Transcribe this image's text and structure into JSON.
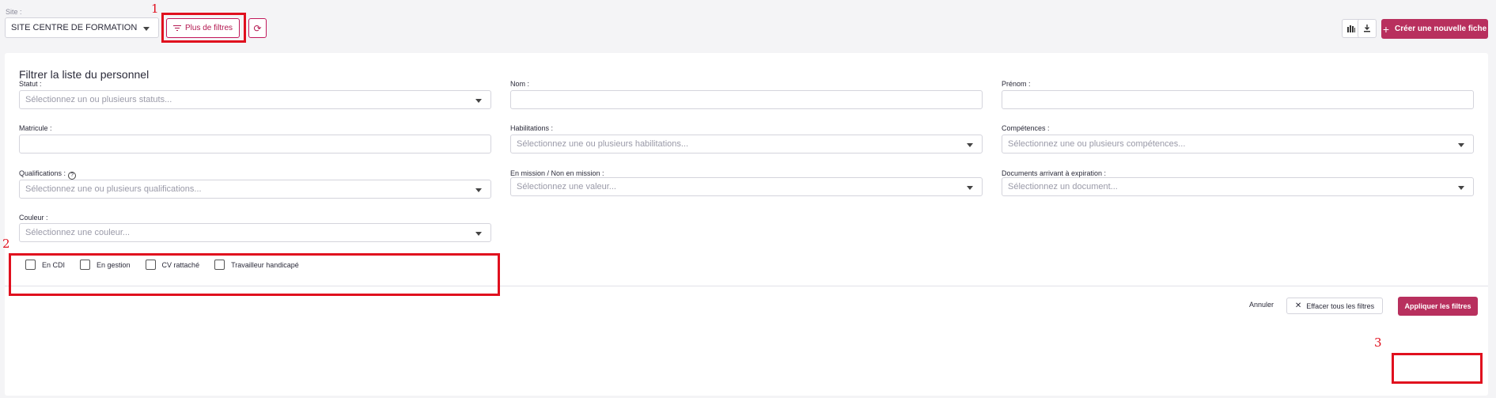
{
  "topbar": {
    "site_label": "Site :",
    "site_value": "SITE CENTRE DE FORMATION",
    "more_filters_label": "Plus de filtres",
    "refresh_glyph": "⟳",
    "stats_icon": "bar-chart-icon",
    "download_icon": "download-icon",
    "create_label": "Créer une nouvelle fiche",
    "create_glyph": "+"
  },
  "panel": {
    "title": "Filtrer la liste du personnel",
    "fields": {
      "statut": {
        "label": "Statut :",
        "placeholder": "Sélectionnez un ou plusieurs statuts..."
      },
      "nom": {
        "label": "Nom :",
        "value": ""
      },
      "prenom": {
        "label": "Prénom :",
        "value": ""
      },
      "matricule": {
        "label": "Matricule :",
        "value": ""
      },
      "habilitations": {
        "label": "Habilitations :",
        "placeholder": "Sélectionnez une ou plusieurs habilitations..."
      },
      "competences": {
        "label": "Compétences :",
        "placeholder": "Sélectionnez une ou plusieurs compétences..."
      },
      "qualifications": {
        "label": "Qualifications :",
        "help_glyph": "?",
        "placeholder": "Sélectionnez une ou plusieurs qualifications..."
      },
      "mission": {
        "label": "En mission / Non en mission :",
        "placeholder": "Sélectionnez une valeur..."
      },
      "documents": {
        "label": "Documents arrivant à expiration :",
        "placeholder": "Sélectionnez un document..."
      },
      "couleur": {
        "label": "Couleur :",
        "placeholder": "Sélectionnez une couleur..."
      }
    },
    "checkboxes": [
      {
        "label": "En CDI",
        "checked": false
      },
      {
        "label": "En gestion",
        "checked": false
      },
      {
        "label": "CV rattaché",
        "checked": false
      },
      {
        "label": "Travailleur handicapé",
        "checked": false
      }
    ],
    "footer": {
      "cancel_label": "Annuler",
      "clear_label": "Effacer tous les filtres",
      "clear_glyph": "✕",
      "apply_label": "Appliquer les filtres"
    }
  },
  "annotations": [
    "1",
    "2",
    "3"
  ],
  "colors": {
    "accent": "#b8305e",
    "annotation": "#e0101e"
  }
}
